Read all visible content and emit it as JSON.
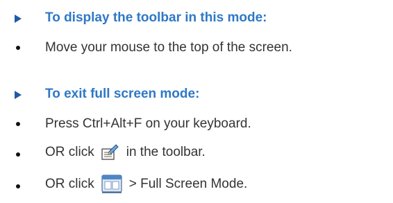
{
  "sections": [
    {
      "heading": "To display the toolbar in this mode:",
      "bullets": [
        {
          "text": "Move your mouse to the top of the screen."
        }
      ]
    },
    {
      "heading": "To exit full screen mode:",
      "bullets": [
        {
          "text": "Press Ctrl+Alt+F on your keyboard."
        },
        {
          "before": "OR click",
          "icon": "edit-document-icon",
          "after": "in the toolbar."
        },
        {
          "before": "OR click",
          "icon": "screen-menu-icon",
          "after": "> Full Screen Mode."
        }
      ]
    }
  ],
  "colors": {
    "heading": "#2f78c6",
    "arrow": "#1f5aa8",
    "body_text": "#333333"
  }
}
